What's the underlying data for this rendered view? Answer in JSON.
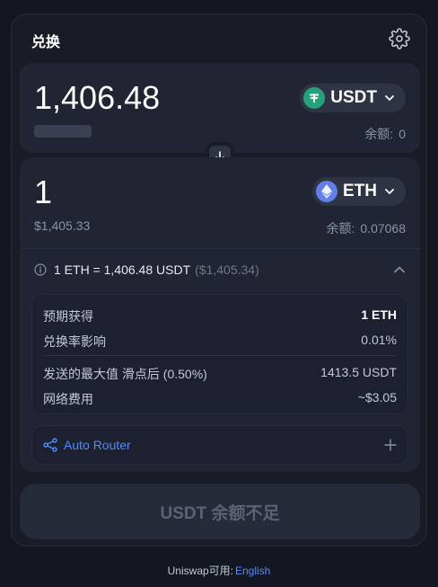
{
  "header": {
    "title": "兑换"
  },
  "input": {
    "amount": "1,406.48",
    "token": {
      "symbol": "USDT",
      "color": "#26a17b"
    },
    "balance_label": "余额:",
    "balance_value": "0"
  },
  "output": {
    "amount": "1",
    "usd_value": "$1,405.33",
    "token": {
      "symbol": "ETH",
      "color": "#627eea"
    },
    "balance_label": "余额:",
    "balance_value": "0.07068"
  },
  "rate": {
    "text": "1 ETH = 1,406.48 USDT",
    "usd": "($1,405.34)"
  },
  "details": {
    "rows": [
      {
        "label": "预期获得",
        "value": "1 ETH"
      },
      {
        "label": "兑换率影响",
        "value": "0.01%"
      },
      {
        "label": "发送的最大值 滑点后 (0.50%)",
        "value": "1413.5 USDT"
      },
      {
        "label": "网络费用",
        "value": "~$3.05"
      }
    ]
  },
  "router": {
    "label": "Auto Router"
  },
  "cta": {
    "label": "USDT 余额不足"
  },
  "footer": {
    "text": "Uniswap可用:",
    "link": "English"
  },
  "colors": {
    "accent": "#4c8dff",
    "background": "#131722",
    "card": "#191c27",
    "panel": "#212533"
  }
}
